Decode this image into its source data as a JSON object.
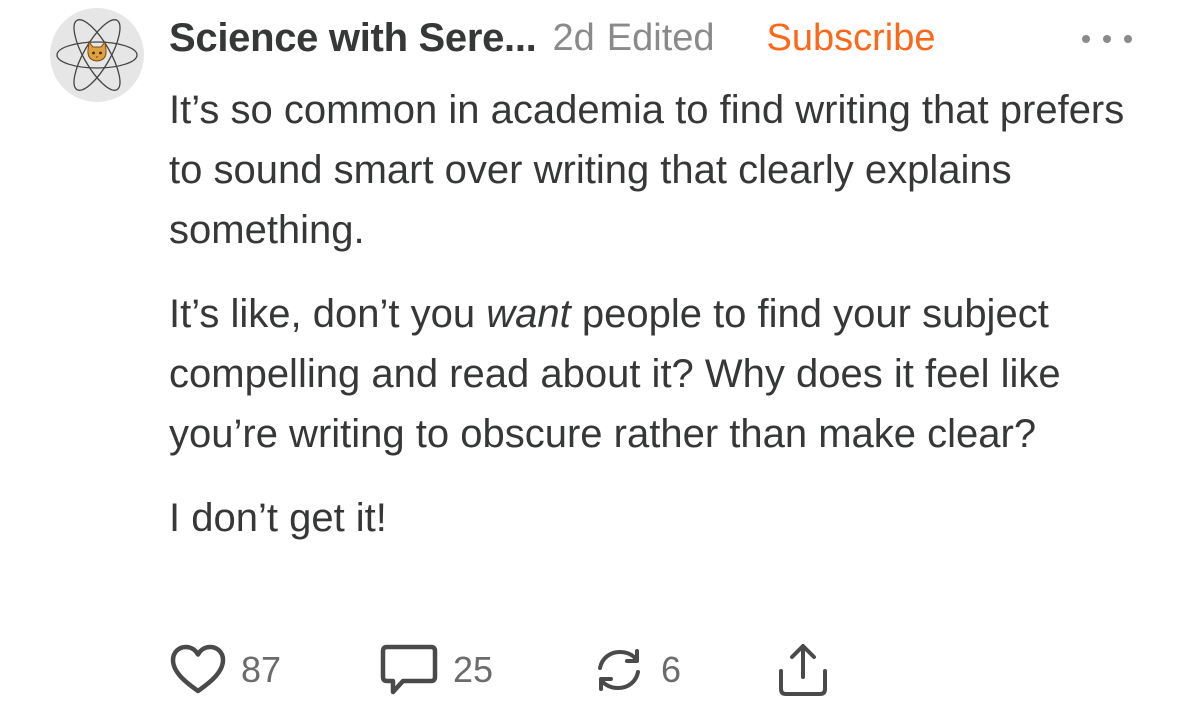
{
  "comment": {
    "author": "Science with Sere...",
    "time": "2d",
    "edited_label": "Edited",
    "subscribe_label": "Subscribe",
    "paragraphs": [
      {
        "text": "It’s so common in academia to find writing that prefers to sound smart over writing that clearly explains something."
      },
      {
        "before": "It’s like, don’t you ",
        "emphasis": "want",
        "after": " people to find your subject compelling and read about it? Why does it feel like you’re writing to obscure rather than make clear?"
      },
      {
        "text": "I don’t get it!"
      }
    ],
    "actions": {
      "likes": "87",
      "comments": "25",
      "restacks": "6"
    }
  },
  "icons": {
    "avatar": "atom-cat-icon",
    "more": "more-dots-icon",
    "like": "heart-icon",
    "comment": "speech-bubble-icon",
    "restack": "restack-arrows-icon",
    "share": "share-upload-icon"
  },
  "colors": {
    "text": "#363737",
    "meta": "#8a8a8a",
    "accent": "#ff6719",
    "avatar_bg": "#e6e6e6"
  }
}
